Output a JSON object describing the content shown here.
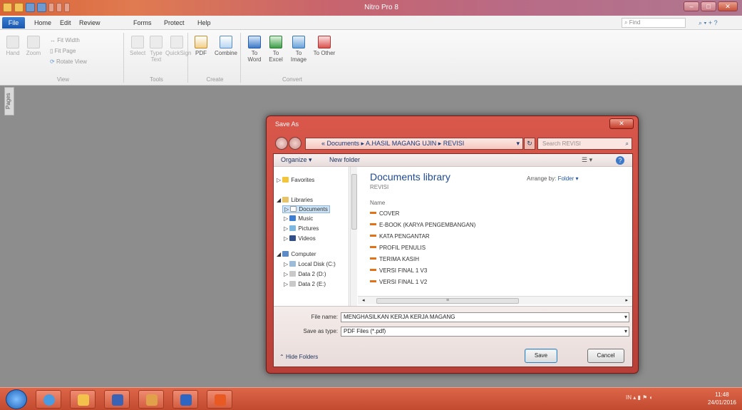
{
  "app": {
    "title": "Nitro Pro 8"
  },
  "menu": {
    "file": "File",
    "tabs": [
      "Home",
      "Edit",
      "Review",
      "Forms",
      "Protect",
      "Help"
    ],
    "find_placeholder": "Find"
  },
  "ribbon": {
    "view": {
      "name": "View",
      "hand": "Hand",
      "zoom": "Zoom",
      "fit_width": "Fit Width",
      "fit_page": "Fit Page",
      "rotate_view": "Rotate View"
    },
    "tools": {
      "name": "Tools",
      "select": "Select",
      "type_text": "Type Text",
      "quicksign": "QuickSign"
    },
    "create": {
      "name": "Create",
      "pdf": "PDF",
      "combine": "Combine"
    },
    "convert": {
      "name": "Convert",
      "to_word": "To Word",
      "to_excel": "To Excel",
      "to_image": "To Image",
      "to_other": "To Other"
    }
  },
  "pages_tab": "Pages",
  "dialog": {
    "title": "Save As",
    "breadcrumb": "« Documents ▸ A.HASIL MAGANG UJIN ▸ REVISI",
    "search_placeholder": "Search REVISI",
    "toolbar": {
      "organize": "Organize ▾",
      "new_folder": "New folder"
    },
    "nav": {
      "favorites": "Favorites",
      "libraries": "Libraries",
      "documents": "Documents",
      "music": "Music",
      "pictures": "Pictures",
      "videos": "Videos",
      "computer": "Computer",
      "local_disk": "Local Disk (C:)",
      "data2_d": "Data 2 (D:)",
      "data2_e": "Data 2 (E:)"
    },
    "library_title": "Documents library",
    "library_sub": "REVISI",
    "arrange_label": "Arrange by:",
    "arrange_value": "Folder ▾",
    "column_name": "Name",
    "files": [
      "COVER",
      "E-BOOK (KARYA PENGEMBANGAN)",
      "KATA PENGANTAR",
      "PROFIL PENULIS",
      "TERIMA KASIH",
      "VERSI FINAL 1 V3",
      "VERSI FINAL 1 V2"
    ],
    "file_name_label": "File name:",
    "file_name_value": "MENGHASILKAN KERJA KERJA MAGANG",
    "save_type_label": "Save as type:",
    "save_type_value": "PDF Files (*.pdf)",
    "hide_folders": "Hide Folders",
    "save_btn": "Save",
    "cancel_btn": "Cancel"
  },
  "taskbar": {
    "lang": "IN",
    "time": "11:48",
    "date": "24/01/2016"
  }
}
